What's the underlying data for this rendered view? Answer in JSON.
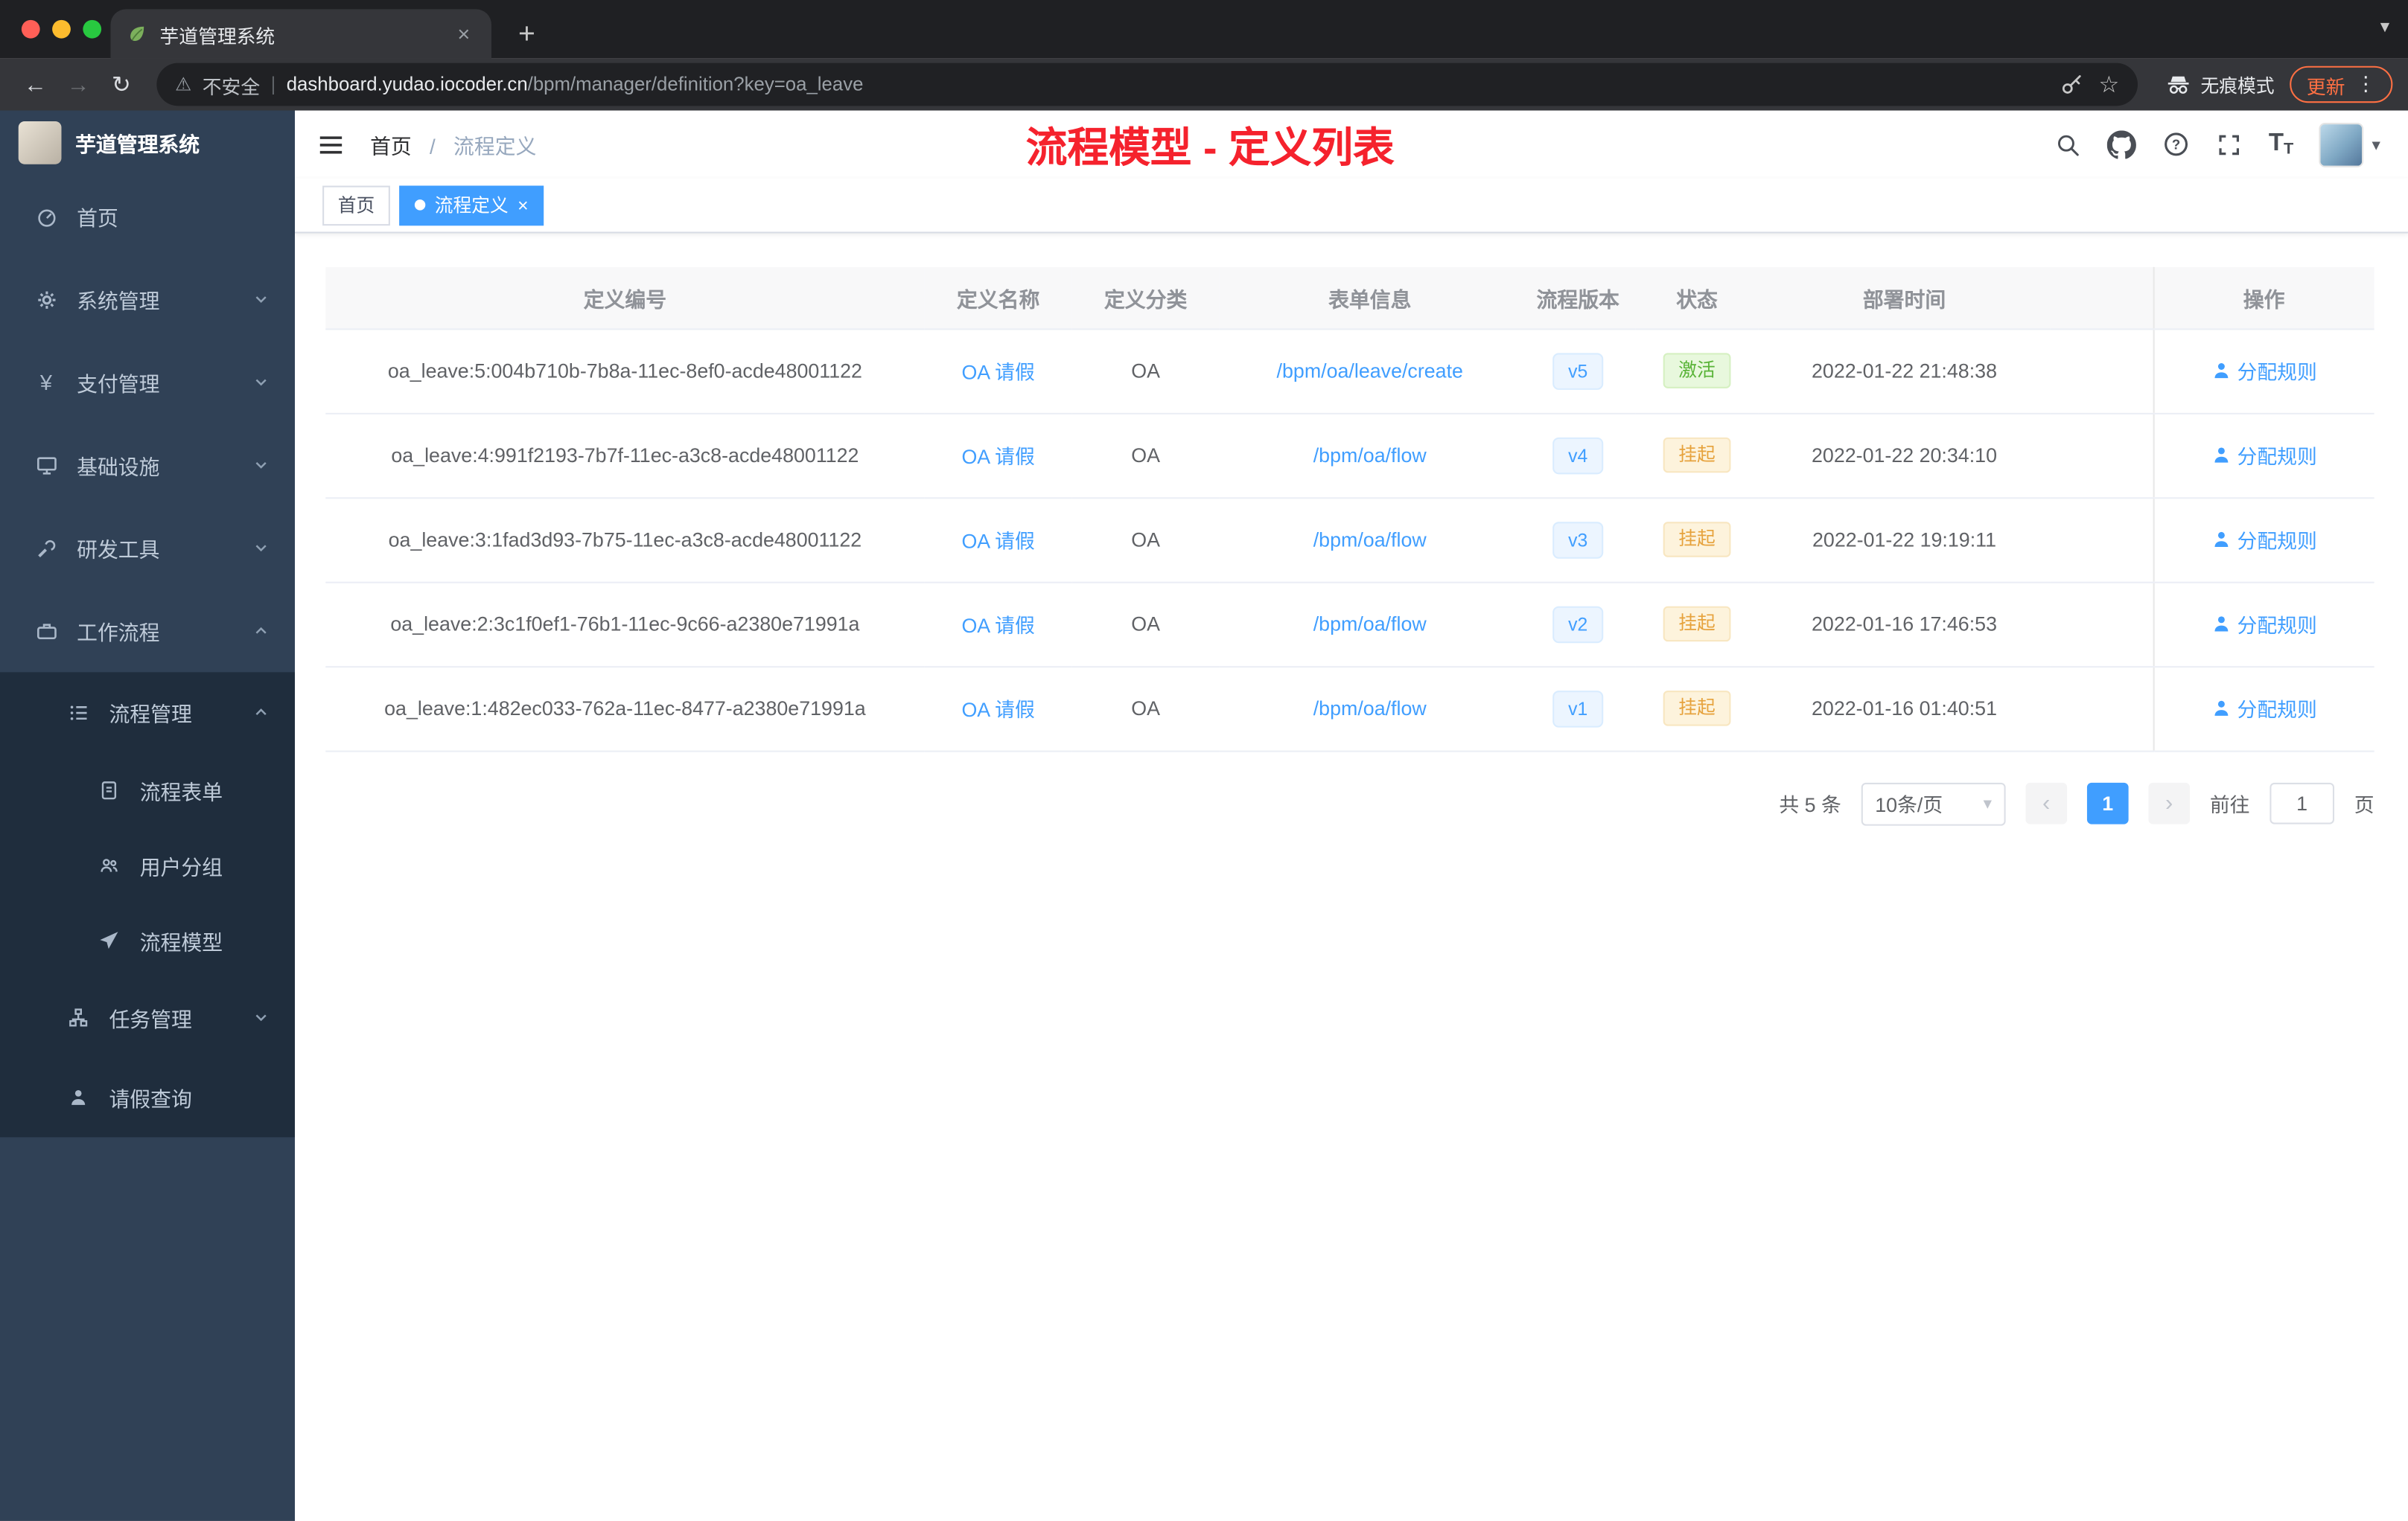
{
  "browser": {
    "tab_title": "芋道管理系统",
    "security_label": "不安全",
    "url_host": "dashboard.yudao.iocoder.cn",
    "url_path": "/bpm/manager/definition?key=oa_leave",
    "incognito_label": "无痕模式",
    "update_label": "更新"
  },
  "glyphs": {
    "back": "←",
    "forward": "→",
    "reload": "↻",
    "warning": "⚠",
    "pipe": "|",
    "kebab": "⋮",
    "close": "×",
    "new_tab": "+",
    "star": "☆",
    "caret": "▾",
    "prev": "‹",
    "next": "›",
    "slash": "/",
    "yen": "¥",
    "text_size_large": "T",
    "text_size_small": "T"
  },
  "sidebar": {
    "logo_title": "芋道管理系统",
    "menu": [
      {
        "label": "首页"
      },
      {
        "label": "系统管理"
      },
      {
        "label": "支付管理"
      },
      {
        "label": "基础设施"
      },
      {
        "label": "研发工具"
      },
      {
        "label": "工作流程"
      }
    ],
    "submenu_process": {
      "label": "流程管理"
    },
    "submenu_items": [
      {
        "label": "流程表单"
      },
      {
        "label": "用户分组"
      },
      {
        "label": "流程模型"
      }
    ],
    "submenu_task": {
      "label": "任务管理"
    },
    "submenu_leave": {
      "label": "请假查询"
    }
  },
  "header": {
    "breadcrumb_home": "首页",
    "breadcrumb_current": "流程定义",
    "annotation": "流程模型 - 定义列表"
  },
  "tags": {
    "home": "首页",
    "active": "流程定义"
  },
  "table": {
    "columns": {
      "id": "定义编号",
      "name": "定义名称",
      "category": "定义分类",
      "form": "表单信息",
      "version": "流程版本",
      "status": "状态",
      "deploy_time": "部署时间",
      "action": "操作"
    },
    "rows": [
      {
        "id": "oa_leave:5:004b710b-7b8a-11ec-8ef0-acde48001122",
        "name": "OA 请假",
        "category": "OA",
        "form": "/bpm/oa/leave/create",
        "version": "v5",
        "status": "激活",
        "status_type": "success",
        "deploy_time": "2022-01-22 21:48:38",
        "action": "分配规则"
      },
      {
        "id": "oa_leave:4:991f2193-7b7f-11ec-a3c8-acde48001122",
        "name": "OA 请假",
        "category": "OA",
        "form": "/bpm/oa/flow",
        "version": "v4",
        "status": "挂起",
        "status_type": "warning",
        "deploy_time": "2022-01-22 20:34:10",
        "action": "分配规则"
      },
      {
        "id": "oa_leave:3:1fad3d93-7b75-11ec-a3c8-acde48001122",
        "name": "OA 请假",
        "category": "OA",
        "form": "/bpm/oa/flow",
        "version": "v3",
        "status": "挂起",
        "status_type": "warning",
        "deploy_time": "2022-01-22 19:19:11",
        "action": "分配规则"
      },
      {
        "id": "oa_leave:2:3c1f0ef1-76b1-11ec-9c66-a2380e71991a",
        "name": "OA 请假",
        "category": "OA",
        "form": "/bpm/oa/flow",
        "version": "v2",
        "status": "挂起",
        "status_type": "warning",
        "deploy_time": "2022-01-16 17:46:53",
        "action": "分配规则"
      },
      {
        "id": "oa_leave:1:482ec033-762a-11ec-8477-a2380e71991a",
        "name": "OA 请假",
        "category": "OA",
        "form": "/bpm/oa/flow",
        "version": "v1",
        "status": "挂起",
        "status_type": "warning",
        "deploy_time": "2022-01-16 01:40:51",
        "action": "分配规则"
      }
    ]
  },
  "pagination": {
    "total": "共 5 条",
    "page_size": "10条/页",
    "page": "1",
    "goto_label": "前往",
    "goto_value": "1",
    "goto_unit": "页"
  },
  "colors": {
    "primary": "#409eff",
    "success": "#67c23a",
    "warning": "#e6a23c",
    "annotation": "#f5222d",
    "update": "#ff7043",
    "sidebar": "#304156",
    "submenu": "#1f2d3d"
  }
}
